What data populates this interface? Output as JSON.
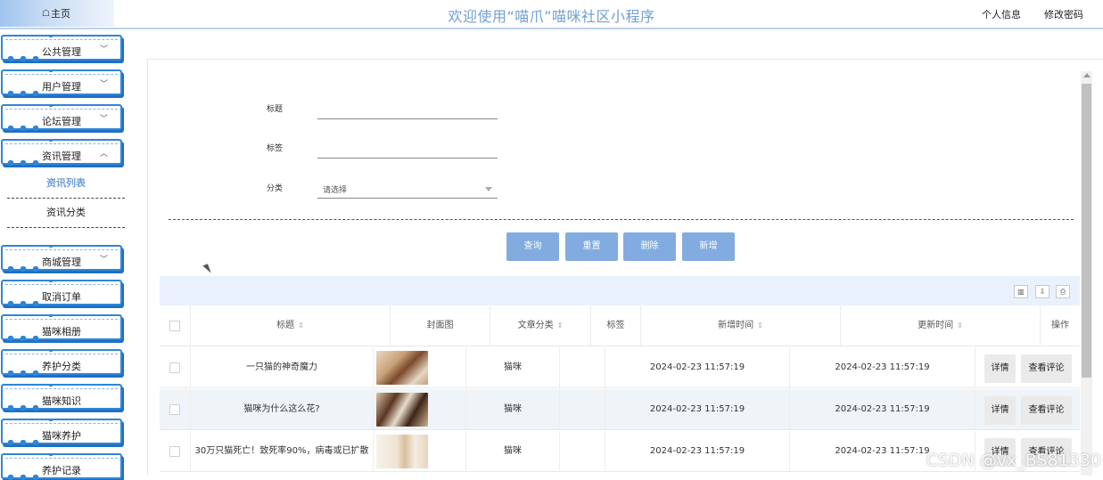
{
  "header": {
    "home_tab": "主页",
    "title": "欢迎使用“喵爪”喵咪社区小程序",
    "links": [
      "个人信息",
      "修改密码"
    ]
  },
  "sidebar": {
    "menus": [
      {
        "label": "公共管理",
        "chevron": "down"
      },
      {
        "label": "用户管理",
        "chevron": "down"
      },
      {
        "label": "论坛管理",
        "chevron": "down"
      },
      {
        "label": "资讯管理",
        "chevron": "up"
      }
    ],
    "subitems": [
      {
        "label": "资讯列表",
        "active": true
      },
      {
        "label": "资讯分类",
        "active": false
      }
    ],
    "menus2": [
      {
        "label": "商城管理",
        "chevron": "down"
      },
      {
        "label": "取消订单",
        "chevron": ""
      },
      {
        "label": "猫咪相册",
        "chevron": ""
      },
      {
        "label": "养护分类",
        "chevron": ""
      },
      {
        "label": "猫咪知识",
        "chevron": ""
      },
      {
        "label": "猫咪养护",
        "chevron": ""
      },
      {
        "label": "养护记录",
        "chevron": ""
      }
    ]
  },
  "search": {
    "title_label": "标题",
    "title_value": "",
    "tag_label": "标签",
    "tag_value": "",
    "category_label": "分类",
    "category_placeholder": "请选择"
  },
  "buttons": {
    "query": "查询",
    "reset": "重置",
    "delete": "删除",
    "add": "新增"
  },
  "toolbar_icons": [
    "columns-icon",
    "export-icon",
    "print-icon"
  ],
  "table": {
    "headers": [
      "标题",
      "封面图",
      "文章分类",
      "标签",
      "新增时间",
      "更新时间",
      "操作"
    ],
    "rows": [
      {
        "title": "一只猫的神奇魔力",
        "category": "猫咪",
        "tag": "",
        "created": "2024-02-23 11:57:19",
        "updated": "2024-02-23 11:57:19",
        "cover_colors": [
          "#d9c4a8",
          "#8a5a3a"
        ],
        "actions": [
          "详情",
          "查看评论"
        ]
      },
      {
        "title": "猫咪为什么这么花?",
        "category": "猫咪",
        "tag": "",
        "created": "2024-02-23 11:57:19",
        "updated": "2024-02-23 11:57:19",
        "cover_colors": [
          "#b89372",
          "#4a2c1a"
        ],
        "actions": [
          "详情",
          "查看评论"
        ]
      },
      {
        "title": "30万只猫死亡！致死率90%，病毒或已扩散",
        "category": "猫咪",
        "tag": "",
        "created": "2024-02-23 11:57:19",
        "updated": "2024-02-23 11:57:19",
        "cover_colors": [
          "#f3ece2",
          "#d9c3a4"
        ],
        "actions": [
          "详情",
          "查看评论"
        ]
      }
    ]
  },
  "watermark": "CSDN @vx_BS81330"
}
